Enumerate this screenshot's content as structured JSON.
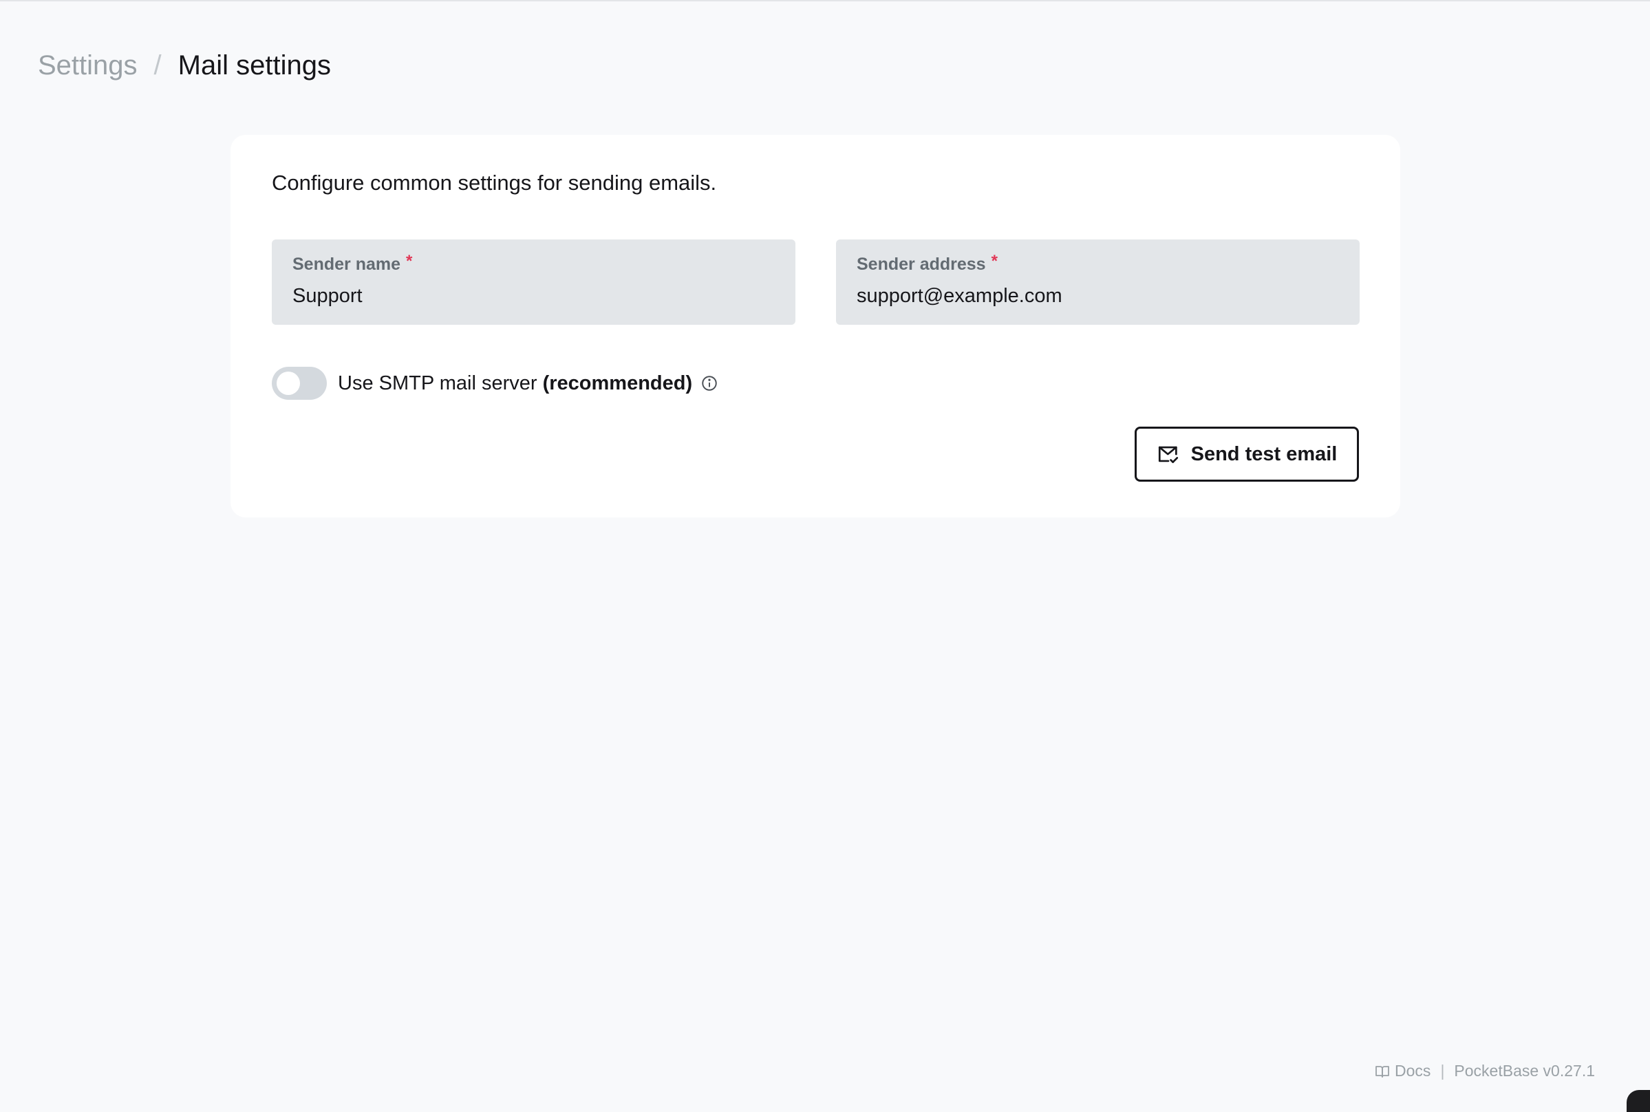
{
  "breadcrumb": {
    "parent": "Settings",
    "separator": "/",
    "current": "Mail settings"
  },
  "card": {
    "description": "Configure common settings for sending emails.",
    "sender_name": {
      "label": "Sender name",
      "required_mark": "*",
      "value": "Support"
    },
    "sender_address": {
      "label": "Sender address",
      "required_mark": "*",
      "value": "support@example.com"
    },
    "smtp_toggle": {
      "label_prefix": "Use SMTP mail server",
      "label_emphasis": "(recommended)",
      "enabled": false
    },
    "test_button": {
      "label": "Send test email",
      "icon": "mail-check-icon"
    }
  },
  "footer": {
    "docs_label": "Docs",
    "separator": "|",
    "version": "PocketBase v0.27.1"
  },
  "colors": {
    "background": "#f8f9fb",
    "card": "#ffffff",
    "field": "#e3e6e9",
    "required": "#e13756",
    "muted_text": "#9aa1a6"
  }
}
